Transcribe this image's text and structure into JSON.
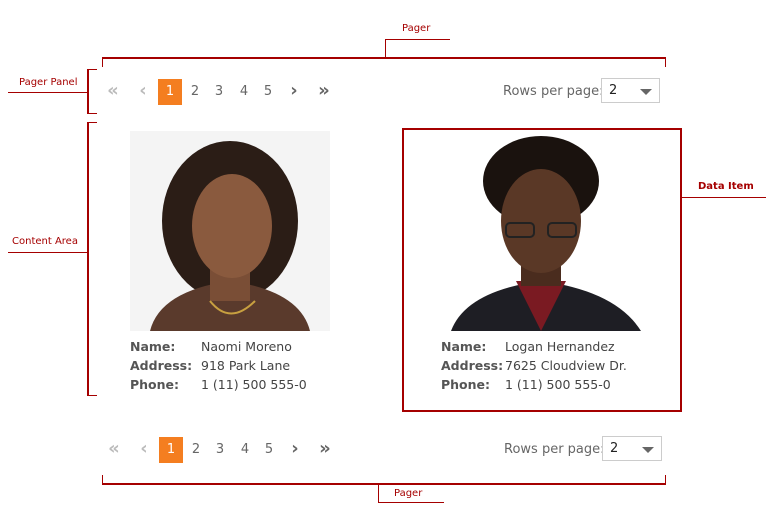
{
  "annotations": {
    "pager_top": "Pager",
    "pager_panel": "Pager Panel",
    "content_area": "Content Area",
    "data_item": "Data Item",
    "pager_bottom": "Pager"
  },
  "pager": {
    "first_icon": "double-chevron-left-icon",
    "prev_icon": "chevron-left-icon",
    "next_icon": "chevron-right-icon",
    "last_icon": "double-chevron-right-icon",
    "pages": [
      "1",
      "2",
      "3",
      "4",
      "5"
    ],
    "current_page": "1",
    "rows_per_page_label": "Rows per page:",
    "rows_per_page_value": "2"
  },
  "items": [
    {
      "name_label": "Name:",
      "name": "Naomi Moreno",
      "address_label": "Address:",
      "address": "918 Park Lane",
      "phone_label": "Phone:",
      "phone": "1 (11) 500 555-0"
    },
    {
      "name_label": "Name:",
      "name": "Logan Hernandez",
      "address_label": "Address:",
      "address": "7625 Cloudview Dr.",
      "phone_label": "Phone:",
      "phone": "1 (11) 500 555-0"
    }
  ],
  "colors": {
    "annotation": "#a50000",
    "accent": "#f47e20"
  }
}
